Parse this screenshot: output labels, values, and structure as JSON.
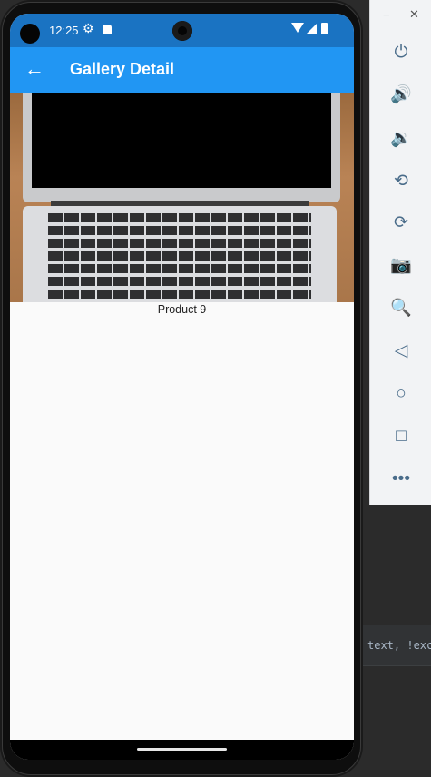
{
  "status_bar": {
    "time": "12:25",
    "icons": [
      "gear-icon",
      "sd-card-icon",
      "wifi-icon",
      "signal-icon",
      "battery-icon"
    ]
  },
  "app_bar": {
    "title": "Gallery Detail",
    "back_icon": "back-arrow-icon",
    "color": "#2196f3"
  },
  "content": {
    "image": "laptop-photo",
    "caption": "Product 9"
  },
  "emulator_toolbar": {
    "window_controls": [
      "minimize-icon",
      "close-icon"
    ],
    "buttons": [
      "power",
      "volume-up",
      "volume-down",
      "rotate-left",
      "rotate-right",
      "screenshot",
      "zoom",
      "back",
      "home",
      "overview",
      "more"
    ]
  },
  "editor_snippet": "text, !exclu"
}
